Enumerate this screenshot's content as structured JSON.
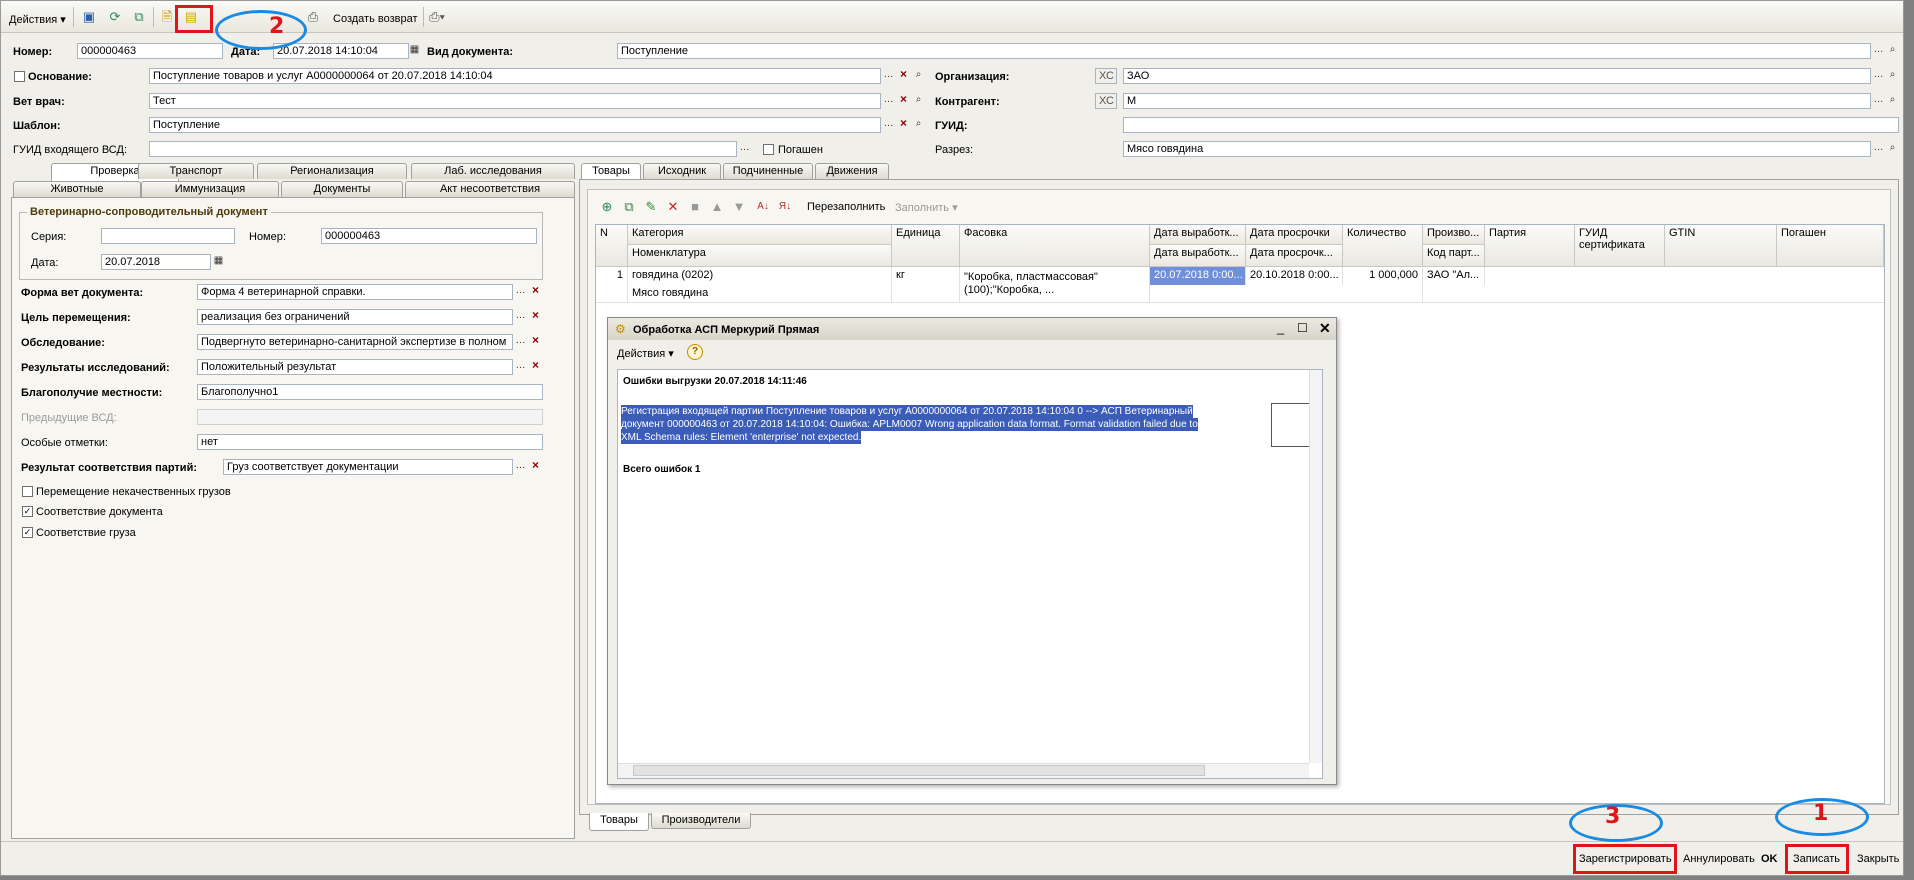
{
  "toolbar": {
    "actions": "Действия",
    "create_return": "Создать возврат"
  },
  "header": {
    "number_label": "Номер:",
    "number": "000000463",
    "date_label": "Дата:",
    "date": "20.07.2018 14:10:04",
    "doc_type_label": "Вид документа:",
    "doc_type": "Поступление",
    "basis_label": "Основание:",
    "basis": "Поступление товаров и услуг А0000000064 от 20.07.2018 14:10:04",
    "org_label": "Организация:",
    "org_prefix": "ХС",
    "org": "ЗАО",
    "vet_label": "Вет врач:",
    "vet": "Тест",
    "contractor_label": "Контрагент:",
    "contractor_prefix": "ХС",
    "contractor": "М",
    "template_label": "Шаблон:",
    "template": "Поступление",
    "guid_label": "ГУИД:",
    "guid": "",
    "guid_vsd_label": "ГУИД входящего ВСД:",
    "guid_vsd": "",
    "repaid_label": "Погашен",
    "cut_label": "Разрез:",
    "cut": "Мясо говядина"
  },
  "left_tabs": {
    "row1": [
      "Проверка",
      "Транспорт",
      "Регионализация",
      "Лаб. исследования"
    ],
    "row2": [
      "Животные",
      "Иммунизация",
      "Документы",
      "Акт несоответствия"
    ]
  },
  "vsd": {
    "group_title": "Ветеринарно-сопроводительный документ",
    "series_label": "Серия:",
    "series": "",
    "number_label": "Номер:",
    "number": "000000463",
    "date_label": "Дата:",
    "date": "20.07.2018",
    "form_label": "Форма вет документа:",
    "form": "Форма 4 ветеринарной справки.",
    "purpose_label": "Цель перемещения:",
    "purpose": "реализация без ограничений",
    "inspection_label": "Обследование:",
    "inspection": "Подвергнуто ветеринарно-санитарной экспертизе в полном",
    "results_label": "Результаты исследований:",
    "results": "Положительный результат",
    "wellbeing_label": "Благополучие местности:",
    "wellbeing": "Благополучно1",
    "prev_label": "Предыдущие ВСД:",
    "prev": "",
    "notes_label": "Особые отметки:",
    "notes": "нет",
    "conformity_label": "Результат соответствия партий:",
    "conformity": "Груз соответствует документации",
    "cb1": "Перемещение некачественных грузов",
    "cb2": "Соответствие документа",
    "cb3": "Соответствие груза"
  },
  "right_tabs": [
    "Товары",
    "Исходник",
    "Подчиненные",
    "Движения"
  ],
  "goods_toolbar": {
    "refill": "Перезаполнить",
    "fill": "Заполнить"
  },
  "table": {
    "headers": {
      "n": "N",
      "category": "Категория",
      "nomenclature": "Номенклатура",
      "unit": "Единица",
      "packing": "Фасовка",
      "prod_date": "Дата выработк...",
      "prod_date2": "Дата выработк...",
      "exp_date": "Дата просрочки",
      "exp_date2": "Дата просрочк...",
      "qty": "Количество",
      "producer": "Произво...",
      "batch_code": "Код парт...",
      "batch": "Партия",
      "guid_cert": "ГУИД сертификата",
      "gtin": "GTIN",
      "repaid": "Погашен"
    },
    "row": {
      "n": "1",
      "category": "говядина (0202)",
      "nomenclature": "Мясо говядина",
      "unit": "кг",
      "packing": "\"Коробка, пластмассовая\"(100);\"Коробка, ...",
      "prod_date": "20.07.2018 0:00...",
      "exp_date": "20.10.2018 0:00...",
      "qty": "1 000,000",
      "producer": "ЗАО \"Ал..."
    }
  },
  "bottom_tabs": [
    "Товары",
    "Производители"
  ],
  "dialog": {
    "title": "Обработка  АСП Меркурий Прямая",
    "actions": "Действия",
    "heading": "Ошибки выгрузки 20.07.2018 14:11:46",
    "message_lines": [
      "Регистрация входящей партии Поступление товаров и услуг А0000000064 от 20.07.2018 14:10:04 0 --> АСП Ветеринарный",
      "документ 000000463 от 20.07.2018 14:10:04: Ошибка: APLM0007 Wrong application data format. Format validation failed due to",
      "XML Schema rules:  Element 'enterprise' not expected."
    ],
    "total": "Всего ошибок 1"
  },
  "footer": {
    "register": "Зарегистрировать",
    "cancel": "Аннулировать",
    "ok": "OK",
    "save": "Записать",
    "close": "Закрыть"
  },
  "annotations": {
    "n1": "1",
    "n2": "2",
    "n3": "3"
  },
  "colors": {
    "annotation_red": "#e0151a",
    "annotation_blue": "#1b8be2",
    "selection": "#3b5db8"
  }
}
